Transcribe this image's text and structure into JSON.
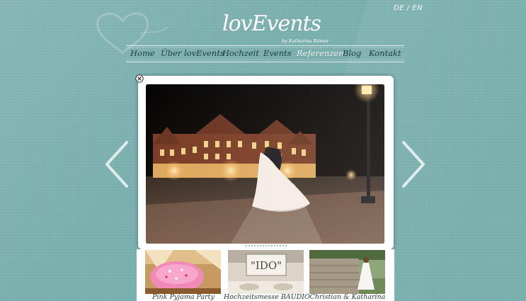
{
  "language_switch": {
    "de": "DE",
    "separator": "/",
    "en": "EN"
  },
  "logo": {
    "text": "lovEvents",
    "subtitle": "by Katharina Römer"
  },
  "nav": {
    "items": [
      {
        "label": "Home"
      },
      {
        "label": "Über lovEvents"
      },
      {
        "label": "Hochzeit"
      },
      {
        "label": "Events"
      },
      {
        "label": "Referenzen",
        "active": true
      },
      {
        "label": "Blog"
      },
      {
        "label": "Kontakt"
      }
    ]
  },
  "slideshow": {
    "slide_count": 16,
    "current_slide": 1
  },
  "thumbnails": [
    {
      "caption": "Pink Pyjama Party"
    },
    {
      "caption": "Hochzeitsmesse BAUDIO"
    },
    {
      "caption": "Christian & Katharina"
    }
  ],
  "thumb_sign_text": "\"IDO\"",
  "colors": {
    "background": "#7ab0ae",
    "nav_text": "#1e3d3c",
    "nav_active": "#ffffff"
  },
  "icons": [
    "heart-outline-icon",
    "close-icon",
    "chevron-left-icon",
    "chevron-right-icon"
  ]
}
